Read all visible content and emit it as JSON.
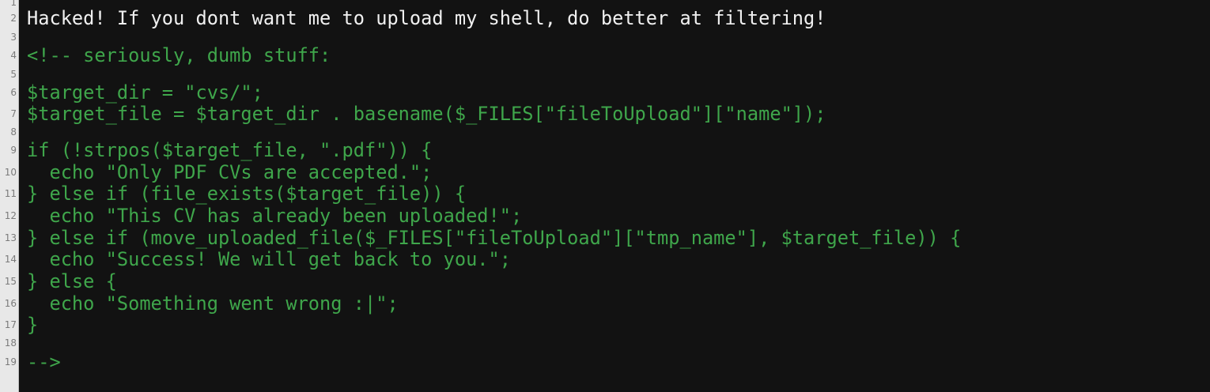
{
  "lines": [
    {
      "number": "1",
      "text": "",
      "kind": "plain"
    },
    {
      "number": "2",
      "text": "Hacked! If you dont want me to upload my shell, do better at filtering!",
      "kind": "plain"
    },
    {
      "number": "3",
      "text": "",
      "kind": "plain"
    },
    {
      "number": "4",
      "text": "<!-- seriously, dumb stuff:",
      "kind": "comment"
    },
    {
      "number": "5",
      "text": "",
      "kind": "comment"
    },
    {
      "number": "6",
      "text": "$target_dir = \"cvs/\";",
      "kind": "comment"
    },
    {
      "number": "7",
      "text": "$target_file = $target_dir . basename($_FILES[\"fileToUpload\"][\"name\"]);",
      "kind": "comment"
    },
    {
      "number": "8",
      "text": "",
      "kind": "comment"
    },
    {
      "number": "9",
      "text": "if (!strpos($target_file, \".pdf\")) {",
      "kind": "comment"
    },
    {
      "number": "10",
      "text": "  echo \"Only PDF CVs are accepted.\";",
      "kind": "comment"
    },
    {
      "number": "11",
      "text": "} else if (file_exists($target_file)) {",
      "kind": "comment"
    },
    {
      "number": "12",
      "text": "  echo \"This CV has already been uploaded!\";",
      "kind": "comment"
    },
    {
      "number": "13",
      "text": "} else if (move_uploaded_file($_FILES[\"fileToUpload\"][\"tmp_name\"], $target_file)) {",
      "kind": "comment"
    },
    {
      "number": "14",
      "text": "  echo \"Success! We will get back to you.\";",
      "kind": "comment"
    },
    {
      "number": "15",
      "text": "} else {",
      "kind": "comment"
    },
    {
      "number": "16",
      "text": "  echo \"Something went wrong :|\";",
      "kind": "comment"
    },
    {
      "number": "17",
      "text": "}",
      "kind": "comment"
    },
    {
      "number": "18",
      "text": "",
      "kind": "comment"
    },
    {
      "number": "19",
      "text": "-->",
      "kind": "comment"
    }
  ],
  "colors": {
    "background": "#121212",
    "plain_text": "#f0f0f0",
    "comment_text": "#3fa64b",
    "gutter": "#e8e8e8"
  }
}
